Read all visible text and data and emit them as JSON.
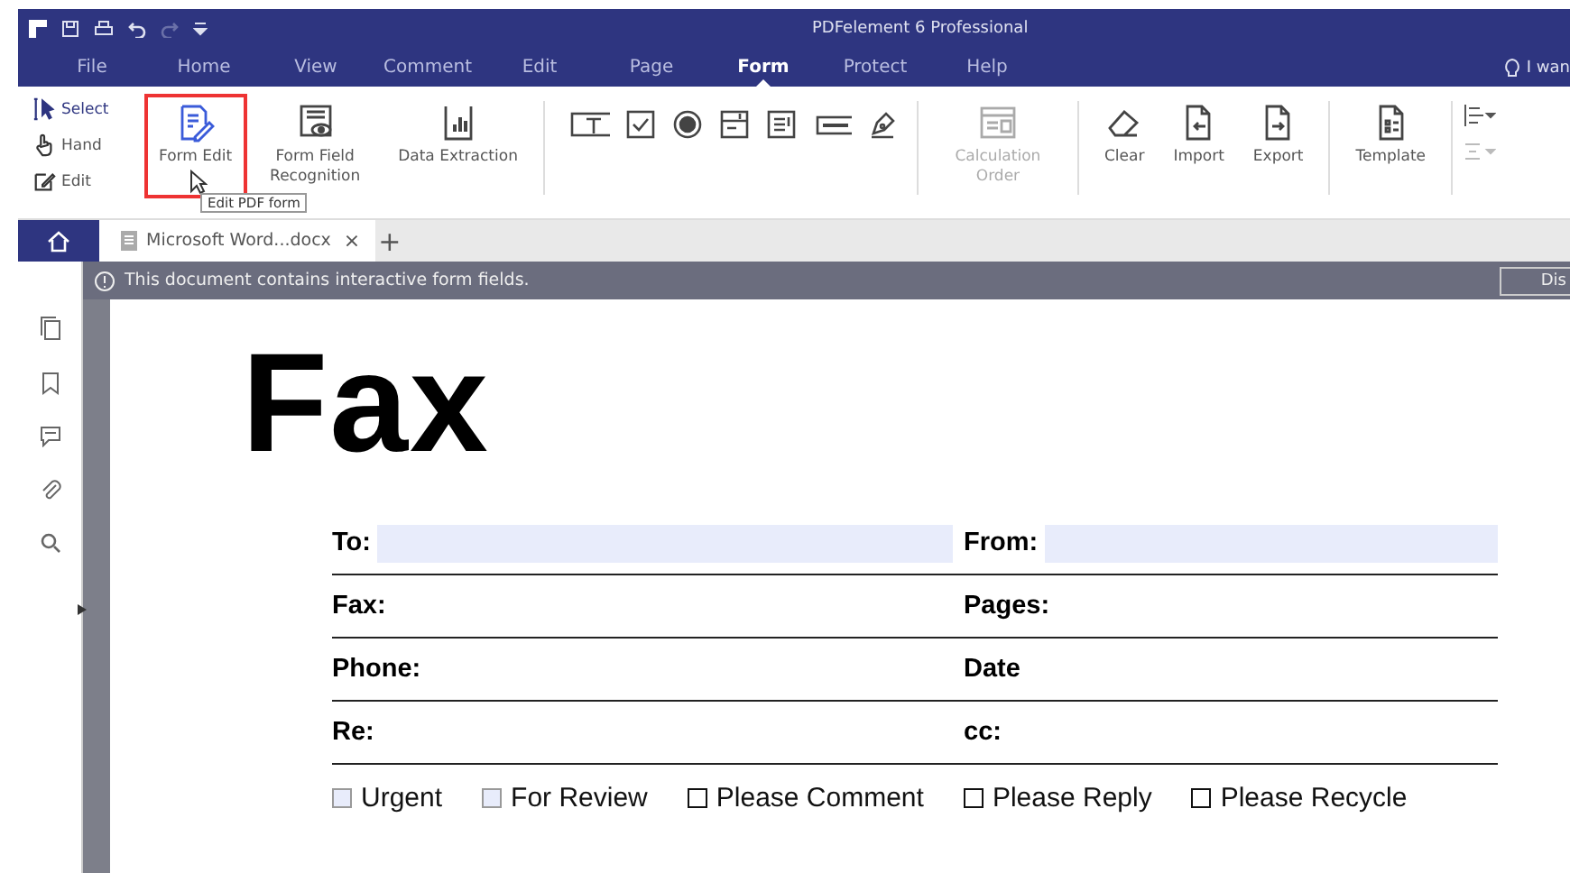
{
  "window": {
    "title": "PDFelement 6 Professional"
  },
  "menu": [
    {
      "label": "File",
      "selected": false
    },
    {
      "label": "Home",
      "selected": false
    },
    {
      "label": "View",
      "selected": false
    },
    {
      "label": "Comment",
      "selected": false
    },
    {
      "label": "Edit",
      "selected": false
    },
    {
      "label": "Page",
      "selected": false
    },
    {
      "label": "Form",
      "selected": true
    },
    {
      "label": "Protect",
      "selected": false
    },
    {
      "label": "Help",
      "selected": false
    }
  ],
  "help_search": "I wan",
  "ribbon": {
    "modes": [
      {
        "label": "Select",
        "selected": true
      },
      {
        "label": "Hand",
        "selected": false
      },
      {
        "label": "Edit",
        "selected": false
      }
    ],
    "large_buttons": [
      {
        "kind": "form-edit",
        "label": "Form Edit",
        "highlighted": true,
        "disabled": false
      },
      {
        "kind": "recognition",
        "label": "Form Field Recognition",
        "highlighted": false,
        "disabled": false
      },
      {
        "kind": "extraction",
        "label": "Data Extraction",
        "highlighted": false,
        "disabled": false
      }
    ],
    "tools": [
      {
        "kind": "text"
      },
      {
        "kind": "checkbox"
      },
      {
        "kind": "radio"
      },
      {
        "kind": "combo"
      },
      {
        "kind": "list"
      },
      {
        "kind": "button"
      },
      {
        "kind": "sign"
      }
    ],
    "action_buttons": [
      {
        "kind": "calc",
        "label": "Calculation Order",
        "disabled": true
      },
      {
        "kind": "clear",
        "label": "Clear",
        "disabled": false
      },
      {
        "kind": "import",
        "label": "Import",
        "disabled": false
      },
      {
        "kind": "export",
        "label": "Export",
        "disabled": false
      },
      {
        "kind": "template",
        "label": "Template",
        "disabled": false
      }
    ]
  },
  "tooltip": "Edit PDF form",
  "doc_tab": {
    "label": "Microsoft Word...docx",
    "close": "×",
    "add": "+"
  },
  "notice": {
    "text": "This document contains interactive form fields.",
    "button": "Dis"
  },
  "document": {
    "title": "Fax",
    "rows": [
      {
        "left": "To:",
        "right": "From:",
        "fields": true
      },
      {
        "left": "Fax:",
        "right": "Pages:",
        "fields": false
      },
      {
        "left": "Phone:",
        "right": "Date",
        "fields": false
      },
      {
        "left": "Re:",
        "right": "cc:",
        "fields": false
      }
    ],
    "checkboxes": [
      {
        "label": "Urgent",
        "kind": "field",
        "checked": false
      },
      {
        "label": "For Review",
        "kind": "field",
        "checked": false
      },
      {
        "label": "Please Comment",
        "kind": "plain",
        "checked": false
      },
      {
        "label": "Please Reply",
        "kind": "plain",
        "checked": false
      },
      {
        "label": "Please Recycle",
        "kind": "plain",
        "checked": false
      }
    ]
  }
}
